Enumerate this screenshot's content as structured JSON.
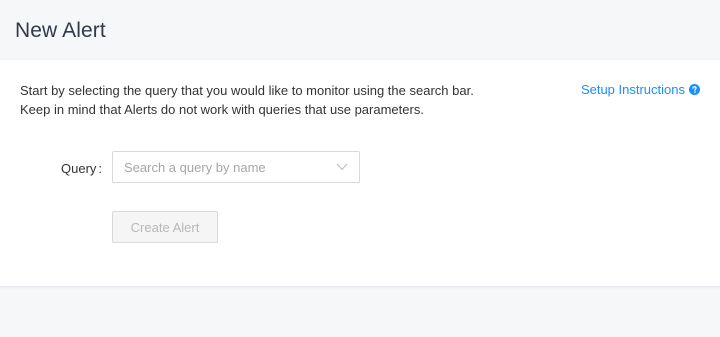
{
  "page": {
    "title": "New Alert"
  },
  "intro": {
    "line1": "Start by selecting the query that you would like to monitor using the search bar.",
    "line2": "Keep in mind that Alerts do not work with queries that use parameters."
  },
  "setup_link": {
    "label": "Setup Instructions",
    "icon": "question-circle-icon"
  },
  "form": {
    "query_label": "Query",
    "query_label_suffix": ":",
    "query_placeholder": "Search a query by name",
    "query_value": "",
    "dropdown_icon": "chevron-down-icon",
    "create_button_label": "Create Alert",
    "create_button_disabled": true
  },
  "colors": {
    "link": "#1890ff",
    "background": "#f6f7f9",
    "card": "#ffffff",
    "disabled_text": "#b8b8b8"
  }
}
